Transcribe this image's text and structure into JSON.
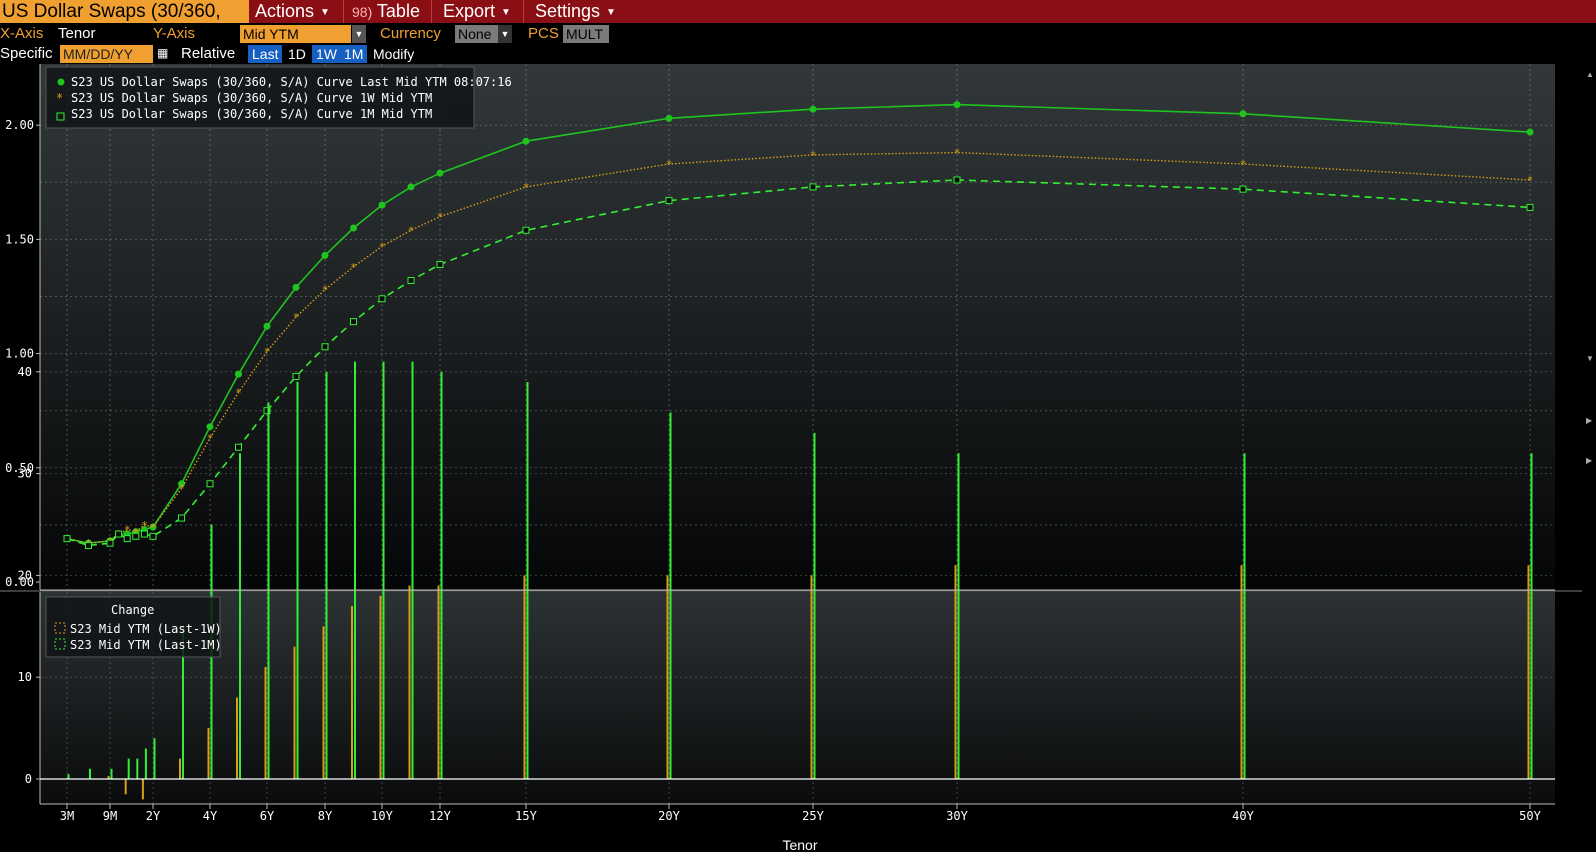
{
  "menubar": {
    "title": "US Dollar Swaps (30/360,",
    "actions": "Actions",
    "table_icon": "98)",
    "table": "Table",
    "export": "Export",
    "settings": "Settings"
  },
  "toolbar": {
    "xaxis_label": "X-Axis",
    "xaxis_value": "Tenor",
    "yaxis_label": "Y-Axis",
    "yaxis_value": "Mid YTM",
    "currency_label": "Currency",
    "currency_value": "None",
    "pcs_label": "PCS",
    "pcs_value": "MULT",
    "specific_label": "Specific",
    "date_placeholder": "MM/DD/YY",
    "relative_label": "Relative",
    "btn_last": "Last",
    "btn_1d": "1D",
    "btn_1w": "1W",
    "btn_1m": "1M",
    "modify": "Modify"
  },
  "colors": {
    "last": "#1fc41f",
    "w1": "#d4a017",
    "m1": "#33ee33",
    "bar_1w": "#d4a017",
    "bar_1m": "#33ee33"
  },
  "chart_data": [
    {
      "type": "line",
      "xlabel": "Tenor",
      "ylim": [
        0,
        2.25
      ],
      "yticks": [
        "0.00",
        "0.50",
        "1.00",
        "1.50",
        "2.00"
      ],
      "x_tick_labels": [
        "3M",
        "9M",
        "2Y",
        "4Y",
        "6Y",
        "8Y",
        "10Y",
        "12Y",
        "15Y",
        "20Y",
        "25Y",
        "30Y",
        "40Y",
        "50Y"
      ],
      "x_tick_years": [
        0.25,
        0.75,
        2,
        4,
        6,
        8,
        10,
        12,
        15,
        20,
        25,
        30,
        40,
        50
      ],
      "grid": true,
      "legend_position": "top-left",
      "x": [
        0.25,
        0.5,
        0.75,
        1,
        1.25,
        1.5,
        1.75,
        2,
        3,
        4,
        5,
        6,
        7,
        8,
        9,
        10,
        11,
        12,
        15,
        20,
        25,
        30,
        40,
        50
      ],
      "series": [
        {
          "name": "S23 US Dollar Swaps (30/360, S/A) Curve Last Mid YTM 08:07:16",
          "marker": "dot",
          "values": [
            0.19,
            0.17,
            0.18,
            0.21,
            0.21,
            0.22,
            0.23,
            0.24,
            0.43,
            0.68,
            0.91,
            1.12,
            1.29,
            1.43,
            1.55,
            1.65,
            1.73,
            1.79,
            1.93,
            2.03,
            2.07,
            2.09,
            2.05,
            1.97
          ]
        },
        {
          "name": "S23 US Dollar Swaps (30/360, S/A) Curve 1W Mid YTM",
          "marker": "star",
          "values": [
            0.19,
            0.17,
            0.18,
            0.21,
            0.23,
            0.22,
            0.25,
            0.24,
            0.41,
            0.63,
            0.83,
            1.01,
            1.16,
            1.28,
            1.38,
            1.47,
            1.54,
            1.6,
            1.73,
            1.83,
            1.87,
            1.88,
            1.83,
            1.76
          ]
        },
        {
          "name": "S23 US Dollar Swaps (30/360, S/A) Curve 1M Mid YTM",
          "marker": "square",
          "values": [
            0.19,
            0.16,
            0.17,
            0.21,
            0.19,
            0.2,
            0.21,
            0.2,
            0.28,
            0.43,
            0.59,
            0.75,
            0.9,
            1.03,
            1.14,
            1.24,
            1.32,
            1.39,
            1.54,
            1.67,
            1.73,
            1.76,
            1.72,
            1.64
          ]
        }
      ]
    },
    {
      "type": "bar",
      "title": "Change",
      "ylim": [
        -5,
        45
      ],
      "yticks": [
        "0",
        "10",
        "20",
        "30",
        "40"
      ],
      "legend_position": "top-left",
      "x": [
        0.25,
        0.5,
        0.75,
        1,
        1.25,
        1.5,
        1.75,
        2,
        3,
        4,
        5,
        6,
        7,
        8,
        9,
        10,
        11,
        12,
        15,
        20,
        25,
        30,
        40,
        50
      ],
      "series": [
        {
          "name": "S23 Mid YTM (Last-1W)",
          "values": [
            0,
            0,
            0.3,
            0,
            -1.5,
            0,
            -2,
            0,
            2,
            5,
            8,
            11,
            13,
            15,
            17,
            18,
            19,
            19,
            20,
            20,
            20,
            21,
            21,
            21
          ]
        },
        {
          "name": "S23 Mid YTM (Last-1M)",
          "values": [
            0.5,
            1,
            1,
            0,
            2,
            2,
            3,
            4,
            15,
            25,
            32,
            37,
            39,
            40,
            41,
            41,
            41,
            40,
            39,
            36,
            34,
            32,
            32,
            32
          ]
        }
      ]
    }
  ]
}
